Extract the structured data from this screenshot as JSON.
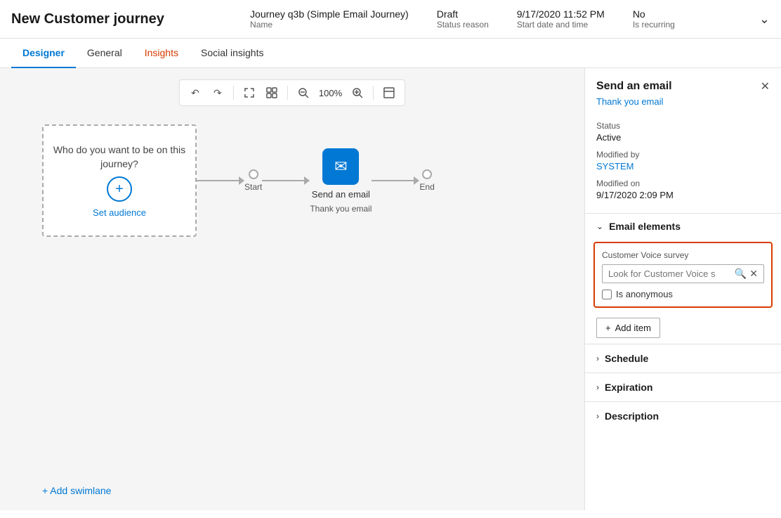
{
  "header": {
    "title": "New Customer journey",
    "meta": {
      "name": {
        "value": "Journey q3b (Simple Email Journey)",
        "label": "Name"
      },
      "status": {
        "value": "Draft",
        "label": "Status reason"
      },
      "date": {
        "value": "9/17/2020 11:52 PM",
        "label": "Start date and time"
      },
      "recurring": {
        "value": "No",
        "label": "Is recurring"
      }
    }
  },
  "tabs": [
    {
      "id": "designer",
      "label": "Designer",
      "active": true
    },
    {
      "id": "general",
      "label": "General",
      "active": false
    },
    {
      "id": "insights",
      "label": "Insights",
      "active": false
    },
    {
      "id": "social-insights",
      "label": "Social insights",
      "active": false
    }
  ],
  "toolbar": {
    "undo": "↺",
    "redo": "↻",
    "zoom_in": "⤡",
    "fit": "⊡",
    "zoom_out_icon": "−",
    "zoom_level": "100%",
    "zoom_in_icon": "+",
    "layout_icon": "⊟"
  },
  "canvas": {
    "audience_text": "Who do you want to be on this journey?",
    "set_audience_label": "Set audience",
    "add_swimlane_label": "+ Add swimlane",
    "steps": [
      {
        "id": "start",
        "label": "Start"
      },
      {
        "id": "email",
        "label": "Send an email",
        "sublabel": "Thank you email"
      },
      {
        "id": "end",
        "label": "End"
      }
    ]
  },
  "right_panel": {
    "title": "Send an email",
    "subtitle": "Thank you email",
    "close_icon": "✕",
    "fields": [
      {
        "label": "Status",
        "value": "Active",
        "type": "text"
      },
      {
        "label": "Modified by",
        "value": "SYSTEM",
        "type": "link"
      },
      {
        "label": "Modified on",
        "value": "9/17/2020 2:09 PM",
        "type": "text"
      }
    ],
    "email_elements": {
      "title": "Email elements",
      "customer_voice": {
        "label": "Customer Voice survey",
        "placeholder": "Look for Customer Voice s",
        "is_anonymous_label": "Is anonymous"
      },
      "add_item_label": "+ Add item"
    },
    "collapsed_sections": [
      {
        "id": "schedule",
        "title": "Schedule"
      },
      {
        "id": "expiration",
        "title": "Expiration"
      },
      {
        "id": "description",
        "title": "Description"
      }
    ]
  }
}
